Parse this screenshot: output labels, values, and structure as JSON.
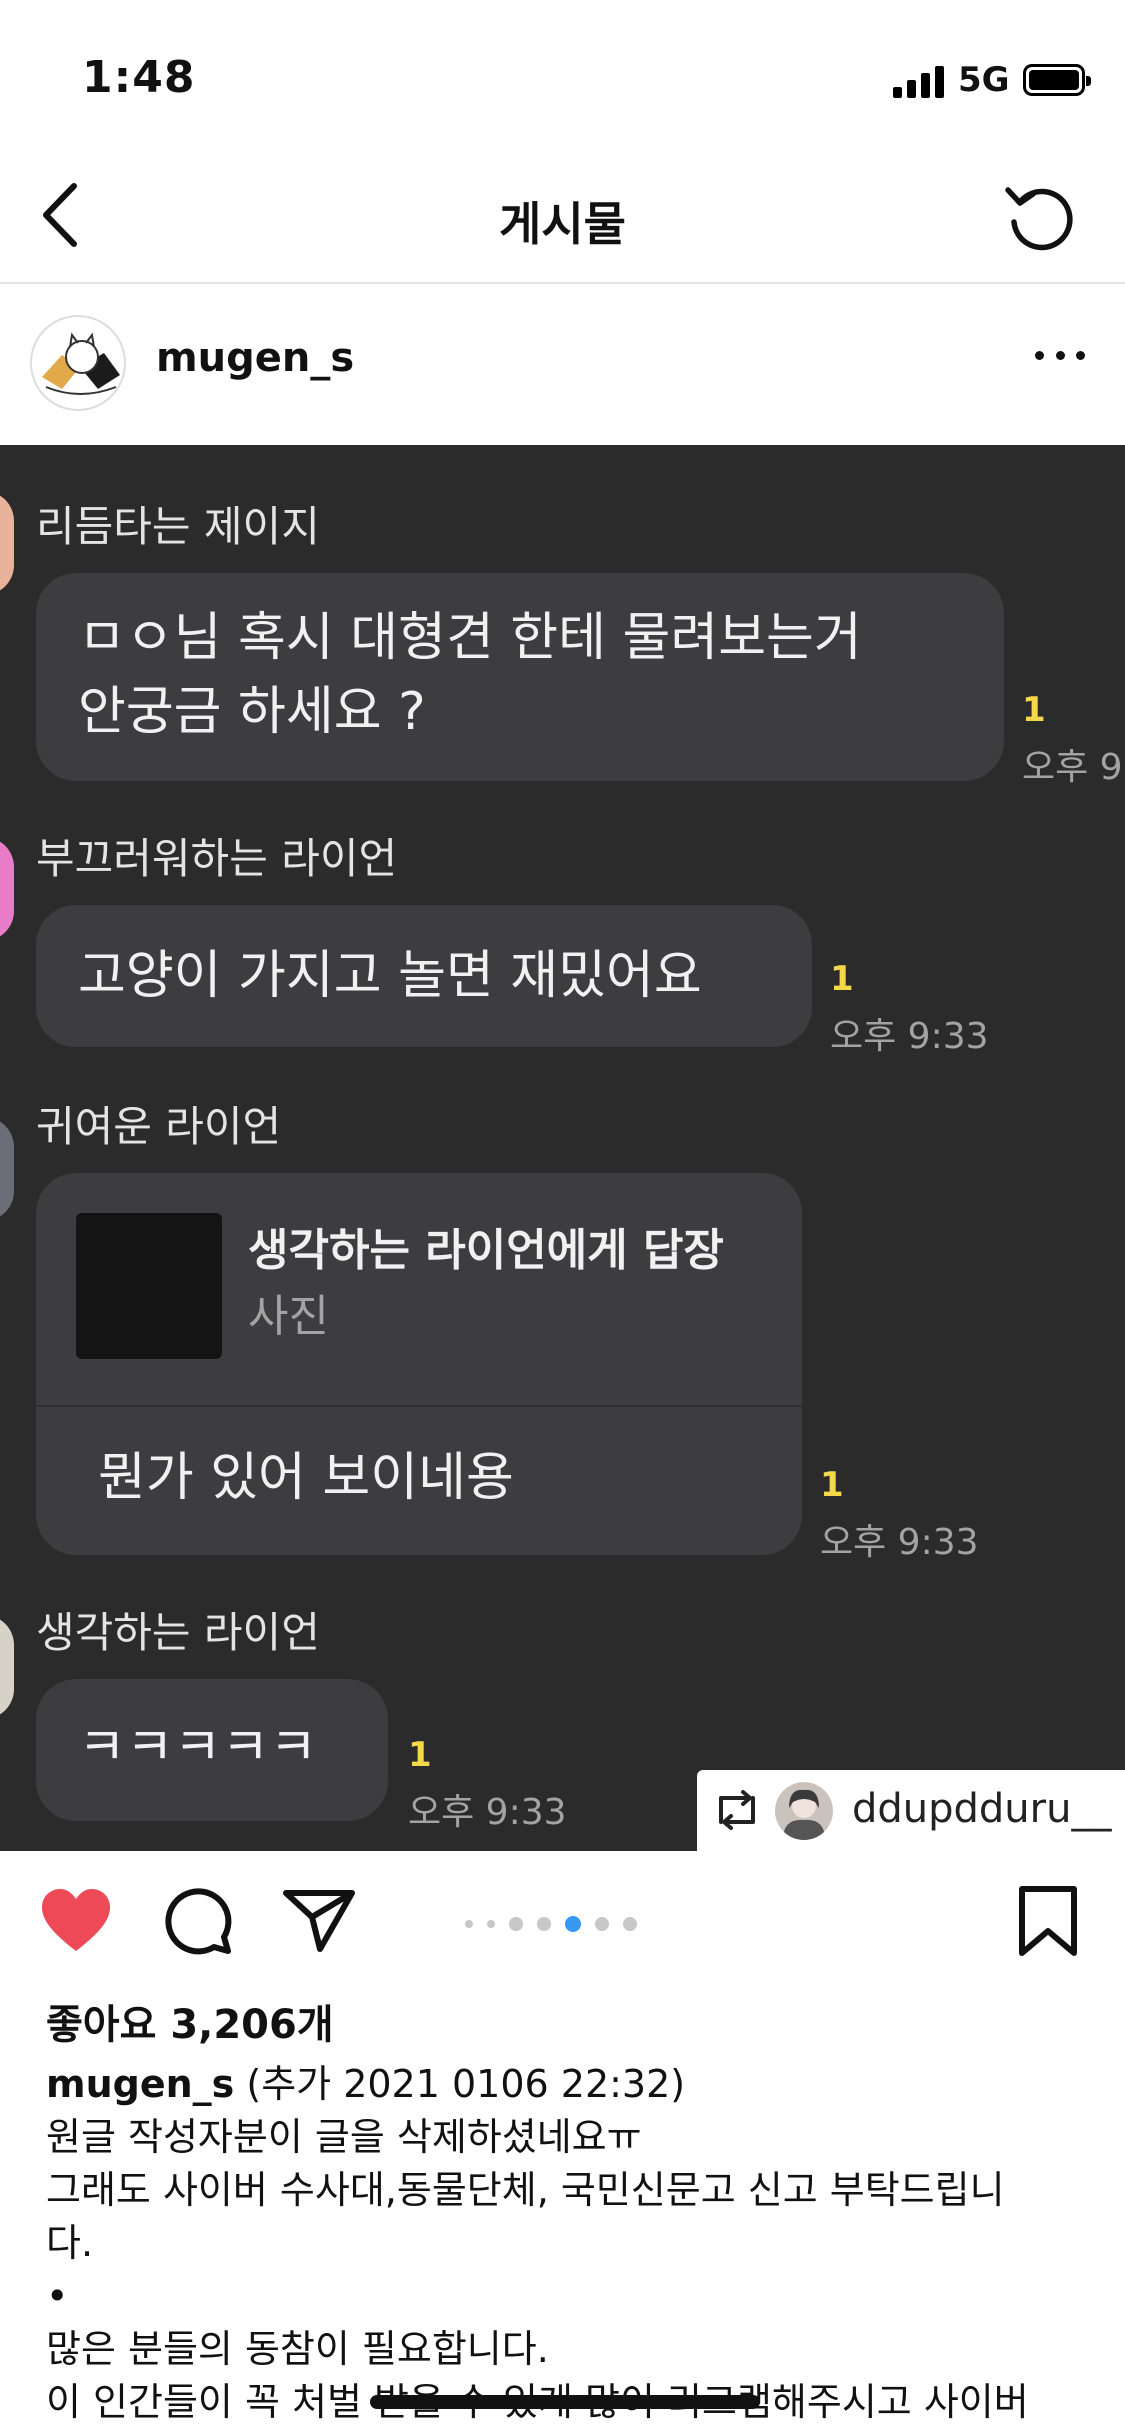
{
  "status_bar": {
    "time": "1:48",
    "network": "5G"
  },
  "nav": {
    "title": "게시물"
  },
  "post": {
    "username": "mugen_s"
  },
  "chat": {
    "messages": [
      {
        "sender": "리듬타는 제이지",
        "lines": [
          "ㅁㅇ님 혹시 대형견 한테 물려보는거",
          "안궁금 하세요 ?"
        ],
        "unread": "1",
        "time": "오후 9"
      },
      {
        "sender": "부끄러워하는 라이언",
        "lines": [
          "고양이 가지고 놀면 재밌어요"
        ],
        "unread": "1",
        "time": "오후 9:33"
      },
      {
        "sender": "귀여운 라이언",
        "reply_to": "생각하는 라이언에게 답장",
        "reply_type": "사진",
        "lines": [
          "뭔가 있어 보이네용"
        ],
        "unread": "1",
        "time": "오후 9:33"
      },
      {
        "sender": "생각하는 라이언",
        "lines": [
          "ㅋㅋㅋㅋㅋ"
        ],
        "unread": "1",
        "time": "오후 9:33"
      }
    ],
    "repost_user": "ddupdduru__"
  },
  "likes": "좋아요 3,206개",
  "caption": {
    "author": "mugen_s",
    "lines": [
      " (추가 2021 0106 22:32)",
      "원글 작성자분이 글을 삭제하셨네요ㅠ",
      "그래도 사이버 수사대,동물단체, 국민신문고 신고 부탁드립니",
      "다.",
      "•",
      "많은 분들의 동참이 필요합니다.",
      "이 인간들이 꼭 처벌 받을 수 있게 많이 리그램해주시고 사이버"
    ]
  },
  "carousel": {
    "count": 7,
    "active": 4
  },
  "colors": {
    "like": "#ed4956",
    "accent": "#3897f0",
    "chat_bg": "#2b2b2b",
    "bubble": "#3d3d3f",
    "unread": "#f5d94a"
  }
}
